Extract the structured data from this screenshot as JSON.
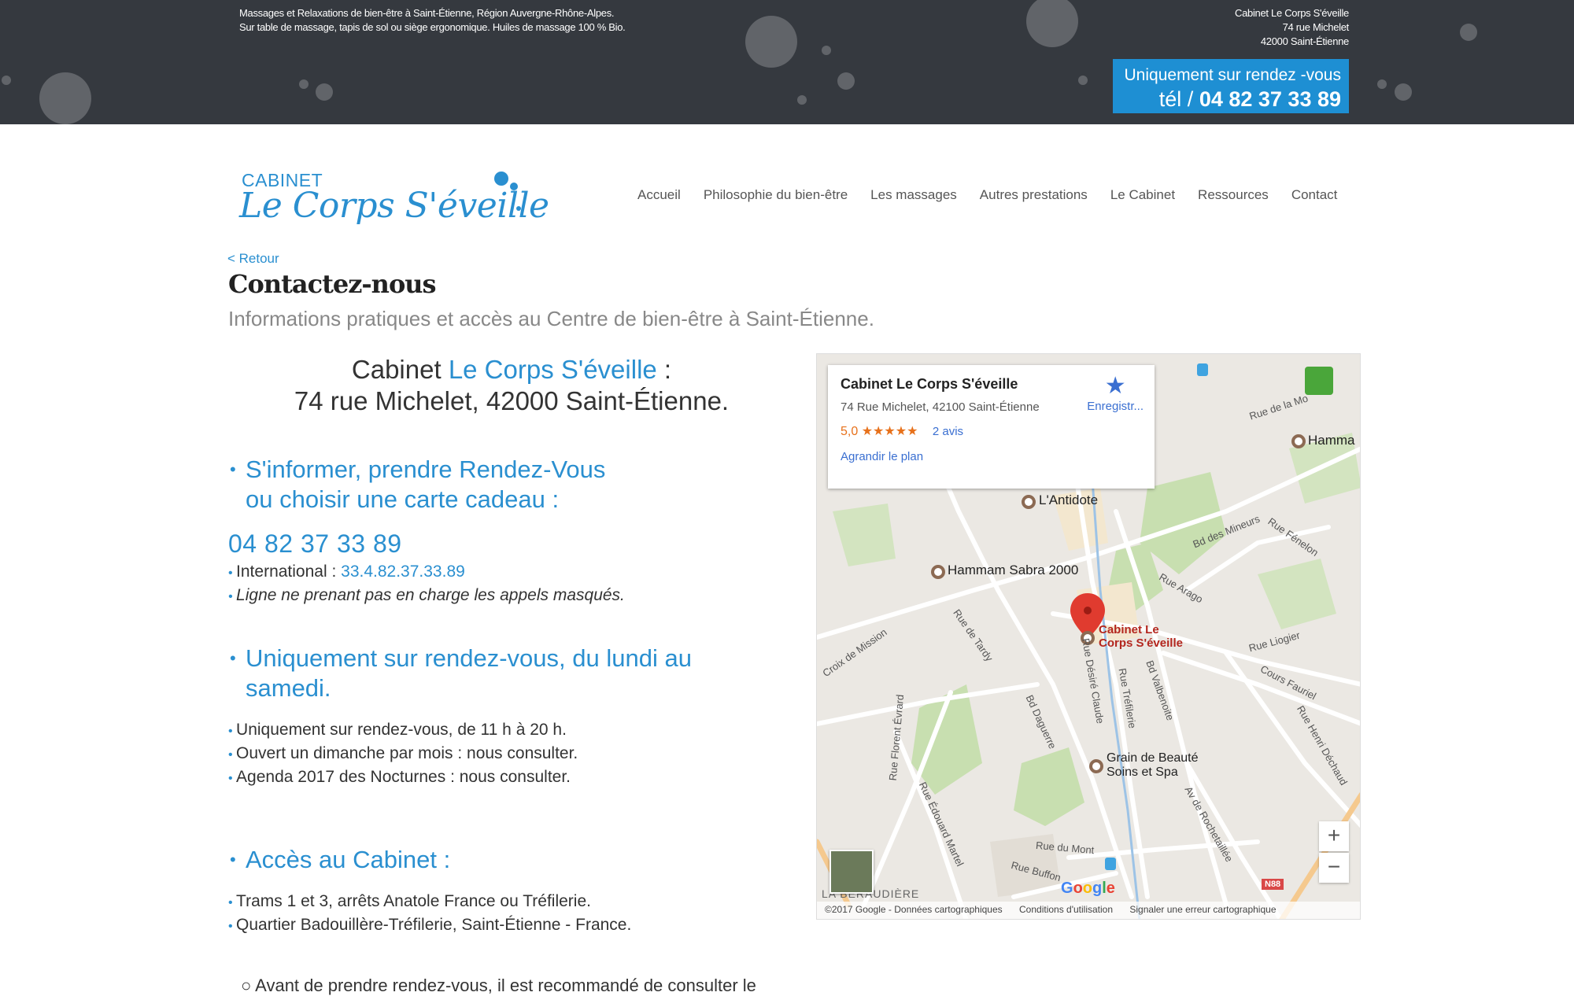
{
  "topbar": {
    "tagline_line1": "Massages et Relaxations de bien-être à Saint-Étienne, Région Auvergne-Rhône-Alpes.",
    "tagline_line2": "Sur table de massage, tapis de sol ou siège ergonomique. Huiles de massage 100 % Bio.",
    "address_line1": "Cabinet Le Corps S'éveille",
    "address_line2": "74 rue Michelet",
    "address_line3": "42000 Saint-Étienne",
    "rdv_line1": "Uniquement sur rendez -vous",
    "rdv_prefix": "tél /",
    "rdv_phone": "04 82 37 33 89",
    "colors": {
      "background": "#35393f",
      "accent": "#1e8fd3"
    }
  },
  "header": {
    "logo_top": "CABINET",
    "logo_name": "Le Corps S'éveille",
    "nav": [
      "Accueil",
      "Philosophie du bien-être",
      "Les massages",
      "Autres prestations",
      "Le Cabinet",
      "Ressources",
      "Contact"
    ]
  },
  "main": {
    "back_link": "< Retour",
    "title": "Contactez-nous",
    "subtitle": "Informations pratiques et accès au Centre de bien-être à Saint-Étienne.",
    "address_prefix": "Cabinet",
    "address_name": "Le Corps S'éveille",
    "address_suffix": ":",
    "address_line2": "74 rue Michelet, 42000 Saint-Étienne.",
    "section1_line1": "S'informer, prendre Rendez-Vous",
    "section1_line2": "ou choisir une carte cadeau :",
    "phone": "04 82 37 33 89",
    "international_label": "International :",
    "international_number": "33.4.82.37.33.89",
    "masked_note": "Ligne ne prenant pas en charge les appels masqués.",
    "section2_line1": "Uniquement sur rendez-vous, du lundi au",
    "section2_line2": "samedi.",
    "hours": [
      "Uniquement sur rendez-vous, de 11 h à 20 h.",
      "Ouvert un dimanche par mois : nous consulter.",
      "Agenda 2017 des Nocturnes : nous consulter."
    ],
    "section3": "Accès au Cabinet :",
    "access": [
      "Trams 1 et 3, arrêts Anatole France ou Tréfilerie.",
      "Quartier Badouillère-Tréfilerie, Saint-Étienne - France."
    ],
    "last_line": "○ Avant de prendre rendez-vous, il est recommandé de consulter le",
    "accent_color": "#2a8fd0"
  },
  "map": {
    "card_title": "Cabinet Le Corps S'éveille",
    "card_address": "74 Rue Michelet, 42100 Saint-Étienne",
    "rating": "5,0 ★★★★★",
    "reviews": "2 avis",
    "enlarge": "Agrandir le plan",
    "save": "Enregistr...",
    "places": {
      "antidote": "L'Antidote",
      "hammam_sabra": "Hammam Sabra 2000",
      "hammam": "Hamma",
      "cabinet_line1": "Cabinet Le",
      "cabinet_line2": "Corps S'éveille",
      "grain_line1": "Grain de Beauté",
      "grain_line2": "Soins et Spa",
      "district": "LA BERAUDIÈRE"
    },
    "streets": {
      "rue_de_la_mo": "Rue de la Mo",
      "bd_des_mineurs": "Bd des Mineurs",
      "rue_fenelon": "Rue Fénelon",
      "rue_arago": "Rue Arago",
      "rue_liogier": "Rue Liogier",
      "cours_fauriel": "Cours Fauriel",
      "rue_henri_dechaud": "Rue Henri Déchaud",
      "croix_de_mission": "Croix de Mission",
      "rue_de_tardy": "Rue de Tardy",
      "bd_daguerre": "Bd Daguerre",
      "rue_desire_claude": "Rue Désiré Claude",
      "rue_trefilerie": "Rue Tréfilerie",
      "bd_valbenoite": "Bd Valbenoite",
      "rue_florent_evrard": "Rue Florent Évrard",
      "rue_edouard_martel": "Rue Édouard Martel",
      "rue_du_mont": "Rue du Mont",
      "rue_buffon": "Rue Buffon",
      "av_rochetaillee": "Av de Rochetaillée"
    },
    "road_badge": "N88",
    "zoom_in": "+",
    "zoom_out": "−",
    "google": "Google",
    "footer": [
      "©2017 Google - Données cartographiques",
      "Conditions d'utilisation",
      "Signaler une erreur cartographique"
    ]
  }
}
